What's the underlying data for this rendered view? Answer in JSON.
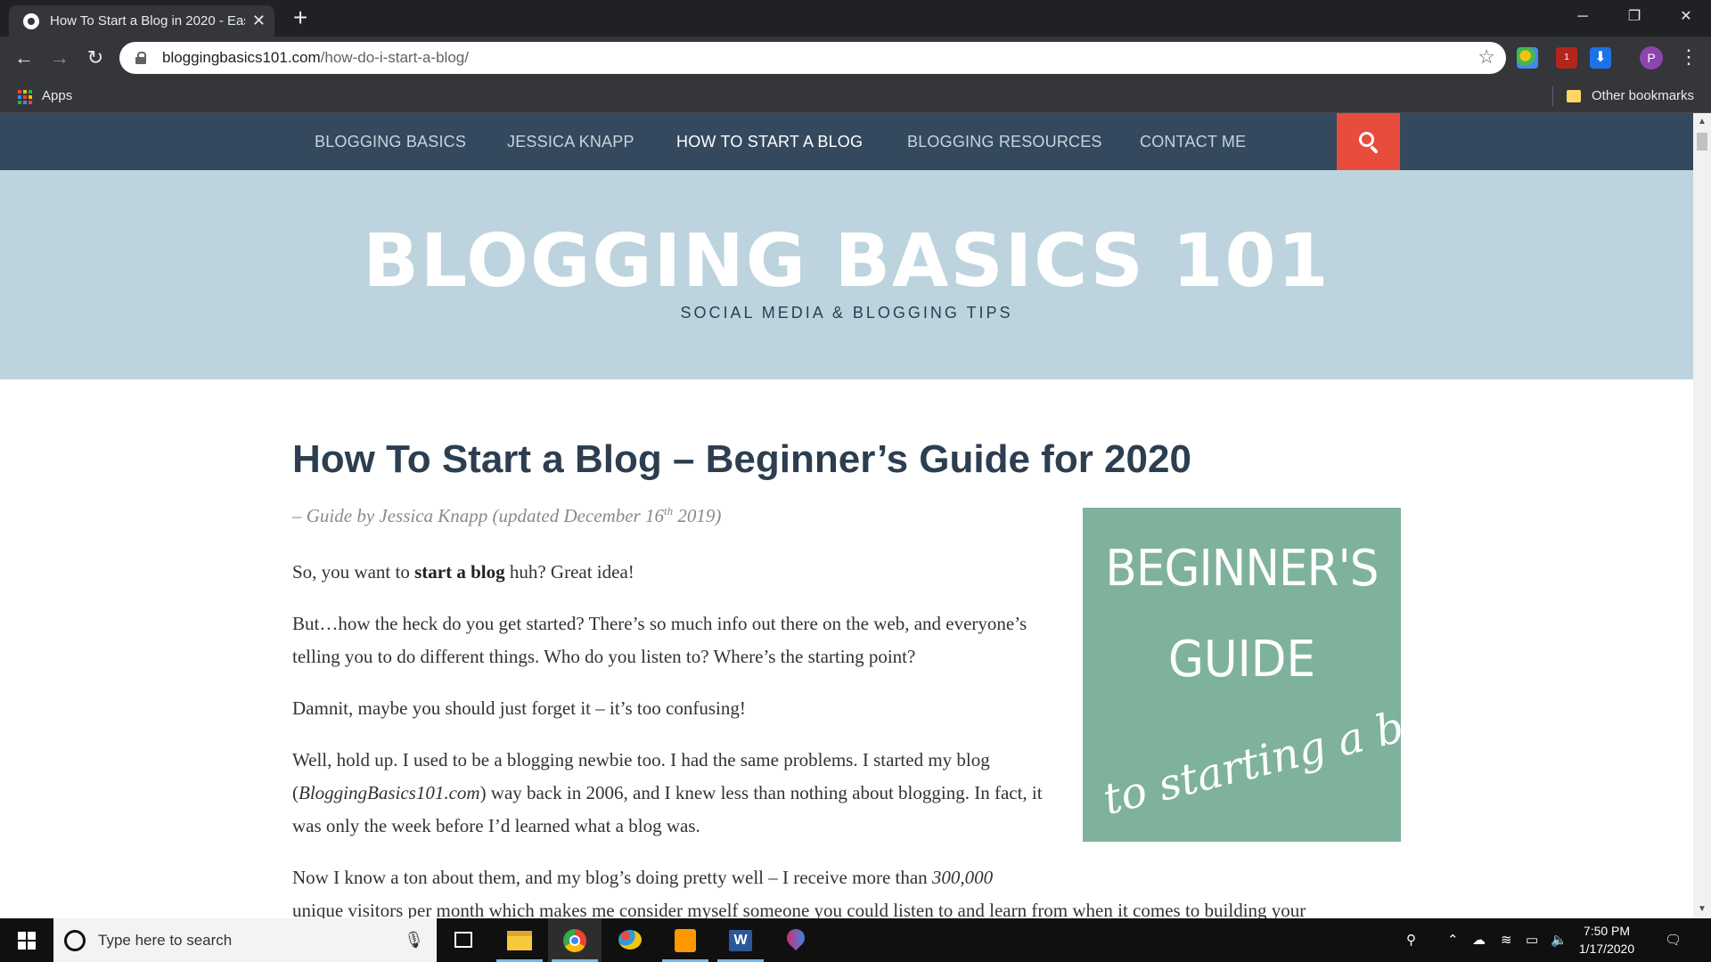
{
  "browser": {
    "tab_title": "How To Start a Blog in 2020 - Eas",
    "new_tab_symbol": "+",
    "close_symbol": "✕",
    "window_controls": {
      "minimize": "─",
      "restore": "❐",
      "close": "✕"
    },
    "url_domain": "bloggingbasics101.com",
    "url_path": "/how-do-i-start-a-blog/",
    "profile_initial": "P",
    "extension_badge": "1",
    "bookmarks": {
      "apps_label": "Apps",
      "other_label": "Other bookmarks"
    }
  },
  "site": {
    "nav": [
      {
        "label": "BLOGGING BASICS",
        "active": false
      },
      {
        "label": "JESSICA KNAPP",
        "active": false
      },
      {
        "label": "HOW TO START A BLOG",
        "active": true
      },
      {
        "label": "BLOGGING RESOURCES",
        "active": false
      },
      {
        "label": "CONTACT ME",
        "active": false
      }
    ],
    "title": "BLOGGING BASICS 101",
    "tagline": "SOCIAL MEDIA & BLOGGING TIPS",
    "colors": {
      "nav_bg": "#34495e",
      "search_bg": "#e74c3c",
      "hero_bg": "#bdd4de",
      "image_bg": "#7fb29d"
    }
  },
  "article": {
    "title": "How To Start a Blog – Beginner’s Guide for 2020",
    "byline_before": "– Guide by Jessica Knapp (updated December 16",
    "byline_sup": "th",
    "byline_after": " 2019)",
    "p1_before": "So, you want to ",
    "p1_bold": "start a blog",
    "p1_after": " huh? Great idea!",
    "p2": "But…how the heck do you get started? There’s so much info out there on the web, and everyone’s telling you to do different things. Who do you listen to? Where’s the starting point?",
    "p3": "Damnit, maybe you should just forget it – it’s too confusing!",
    "p4_before": "Well, hold up. I used to be a blogging newbie too. I had the same problems. I started my blog (",
    "p4_italic": "BloggingBasics101.com",
    "p4_after": ") way back in 2006, and I knew less than nothing about blogging. In fact, it was only the week before I’d learned what a blog was.",
    "p5_line1_before": "Now I know a ton about them, and my blog’s doing pretty well – I receive more than ",
    "p5_line1_italic": "300,000",
    "p5_line2": "unique visitors per month which makes me consider myself someone you could listen to and learn from when it comes to building your",
    "image": {
      "line1": "BEGINNER'S",
      "line2": "GUIDE",
      "script": "to starting a blog"
    }
  },
  "taskbar": {
    "search_placeholder": "Type here to search",
    "time": "7:50 PM",
    "date": "1/17/2020"
  }
}
